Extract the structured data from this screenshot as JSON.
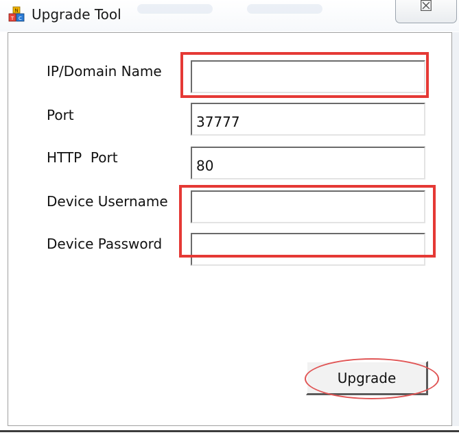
{
  "window": {
    "title": "Upgrade Tool",
    "close_label": "☒"
  },
  "form": {
    "ip_label": "IP/Domain Name",
    "ip_value": "",
    "port_label": "Port",
    "port_value": "37777",
    "http_port_label": "HTTP  Port",
    "http_port_value": "80",
    "username_label": "Device Username",
    "username_value": "",
    "password_label": "Device Password",
    "password_value": ""
  },
  "actions": {
    "upgrade_label": "Upgrade"
  },
  "colors": {
    "highlight": "#e53935"
  },
  "icons": {
    "app": "app-icon",
    "close": "close-icon"
  }
}
